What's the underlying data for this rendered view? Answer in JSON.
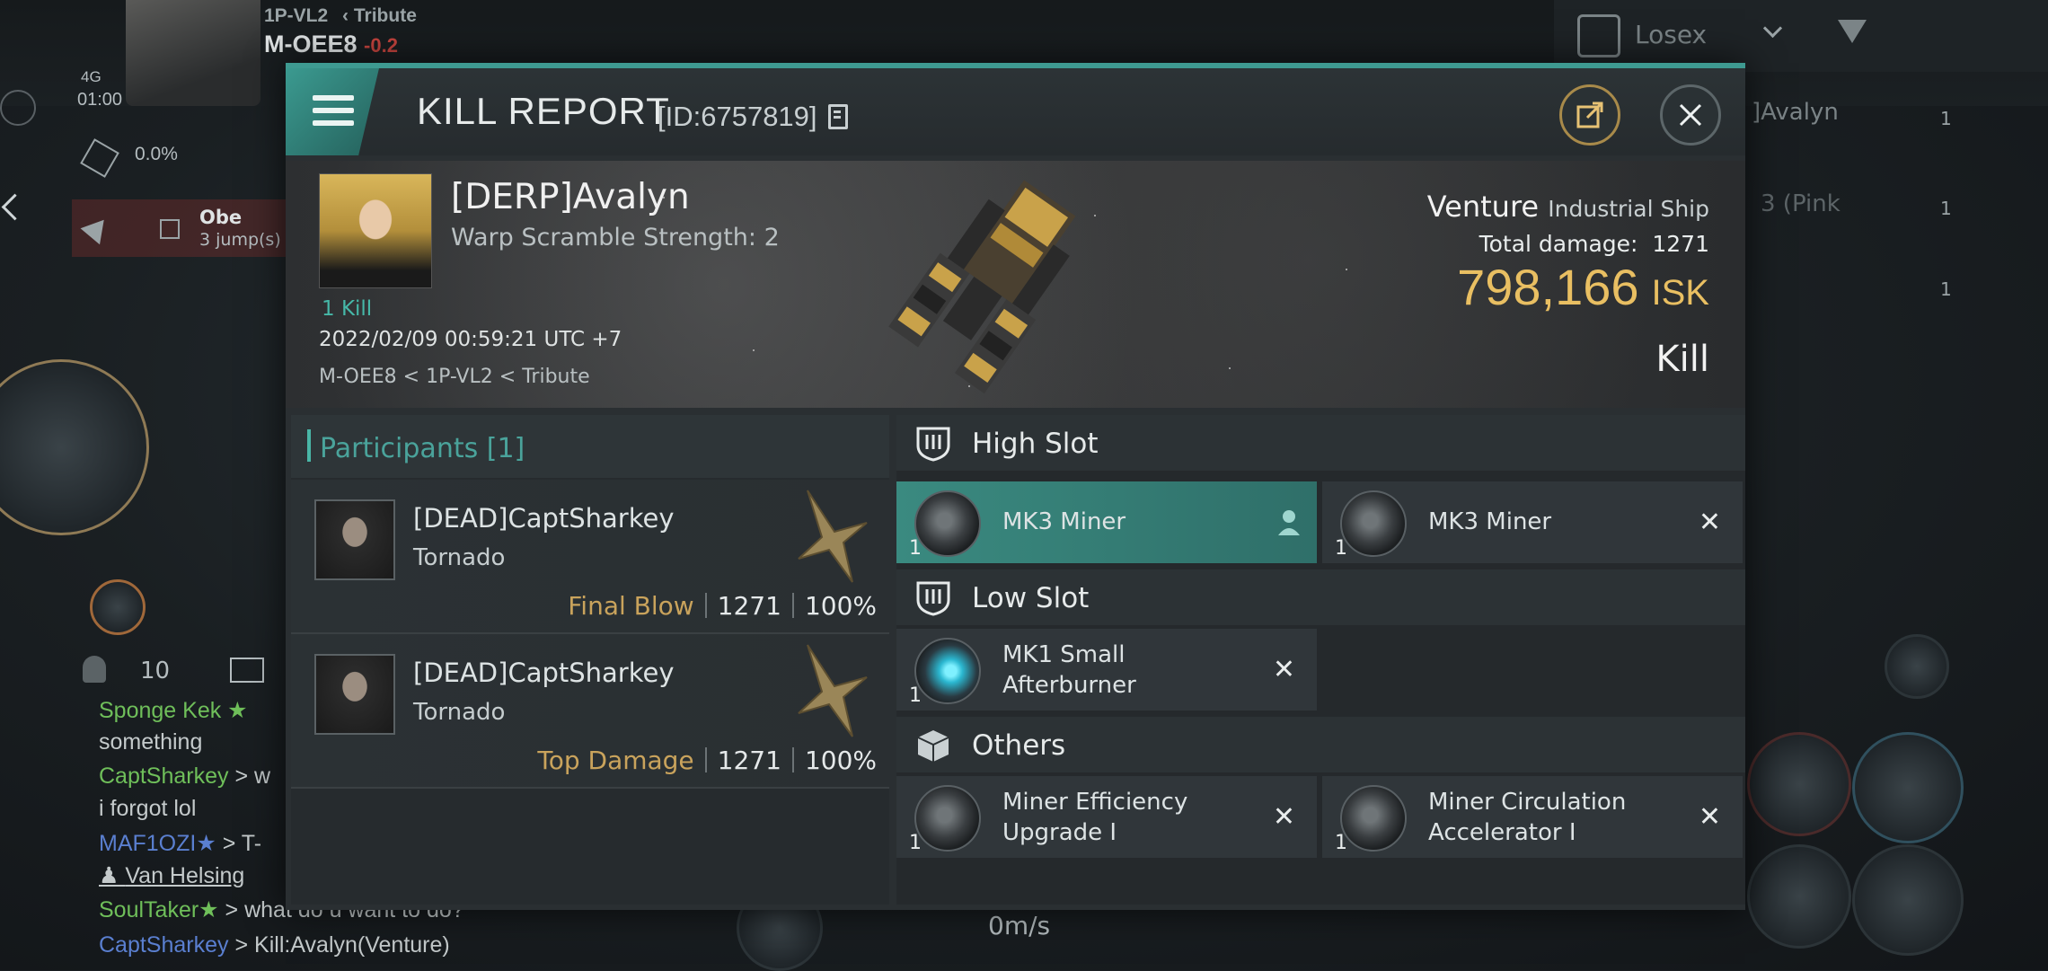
{
  "hud": {
    "system_route": "1P-VL2",
    "system_region": "Tribute",
    "system_name": "M-OEE8",
    "security": "-0.2",
    "signal": "4G",
    "clock": "01:00",
    "cargo_percent": "0.0%",
    "overview_filter": "Losex",
    "side_names": [
      "]Avalyn",
      "3 (Pink"
    ],
    "side_counts": [
      "1",
      "1",
      "1"
    ],
    "route_item": "Obe",
    "route_jumps": "3 jump(s)",
    "crew_count": "10",
    "speed": "0m/s",
    "chat": [
      {
        "name": "Sponge Kek",
        "text": ""
      },
      {
        "name": "",
        "text": "something"
      },
      {
        "name": "CaptSharkey",
        "text": "> w"
      },
      {
        "name": "",
        "text": "i forgot lol"
      },
      {
        "name": "MAF1OZI",
        "text": ">  T-"
      },
      {
        "name": "",
        "text": "Van Helsing"
      },
      {
        "name": "SoulTaker",
        "text": "> what do u want to do?"
      },
      {
        "name": "CaptSharkey",
        "text": "> Kill:Avalyn(Venture)"
      }
    ]
  },
  "report": {
    "title": "KILL REPORT",
    "id": "[ID:6757819]",
    "victim": {
      "name": "[DERP]Avalyn",
      "warp_scramble": "Warp Scramble Strength:  2",
      "kills": "1 Kill",
      "datetime": "2022/02/09 00:59:21 UTC +7",
      "location": "M-OEE8 < 1P-VL2 < Tribute"
    },
    "ship_name": "Venture",
    "ship_class": "Industrial Ship",
    "total_damage_label": "Total damage:",
    "total_damage": "1271",
    "isk_value": "798,166",
    "isk_unit": "ISK",
    "result": "Kill",
    "participants_label": "Participants [1]",
    "participants": [
      {
        "name": "[DEAD]CaptSharkey",
        "ship": "Tornado",
        "tag": "Final Blow",
        "damage": "1271",
        "percent": "100%"
      },
      {
        "name": "[DEAD]CaptSharkey",
        "ship": "Tornado",
        "tag": "Top Damage",
        "damage": "1271",
        "percent": "100%"
      }
    ],
    "sections": {
      "high": "High Slot",
      "low": "Low Slot",
      "others": "Others"
    },
    "high_slots": [
      {
        "name": "MK3 Miner",
        "qty": "1"
      },
      {
        "name": "MK3 Miner",
        "qty": "1"
      }
    ],
    "low_slots": [
      {
        "name_line1": "MK1 Small",
        "name_line2": "Afterburner",
        "qty": "1"
      }
    ],
    "other_slots": [
      {
        "name_line1": "Miner Efficiency",
        "name_line2": "Upgrade I",
        "qty": "1"
      },
      {
        "name_line1": "Miner Circulation",
        "name_line2": "Accelerator I",
        "qty": "1"
      }
    ]
  }
}
